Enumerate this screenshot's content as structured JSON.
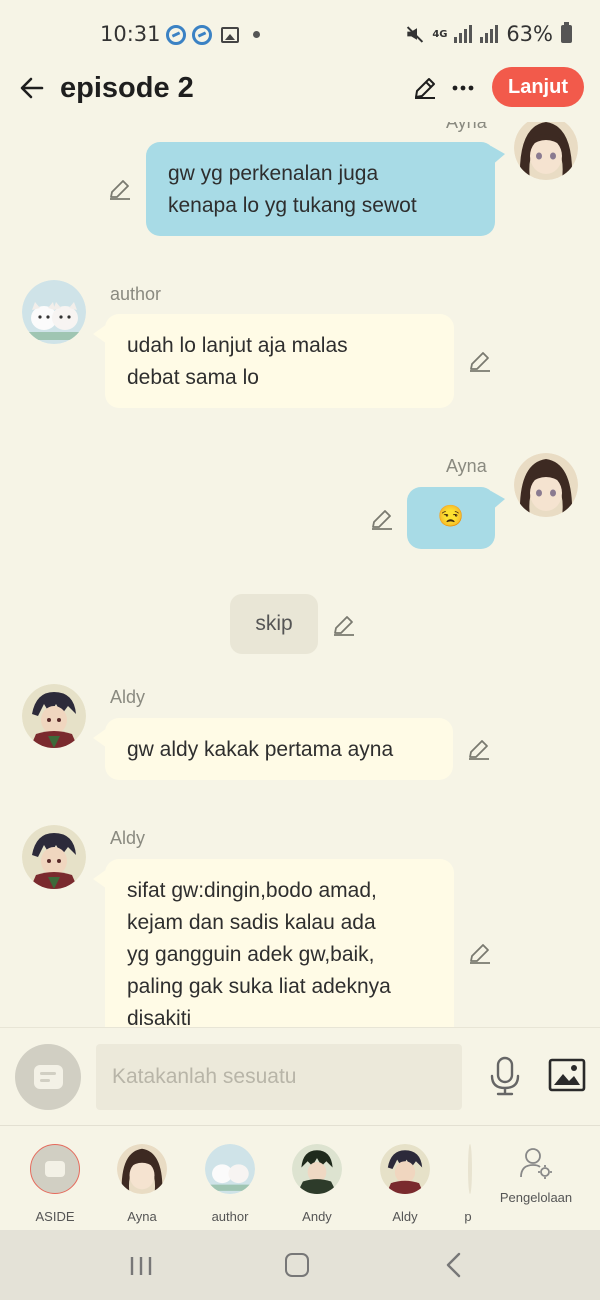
{
  "status_bar": {
    "time": "10:31",
    "network": "4G",
    "battery": "63%"
  },
  "header": {
    "title": "episode 2",
    "continue_button": "Lanjut"
  },
  "messages": [
    {
      "sender": "Ayna",
      "side": "right",
      "text": "gw yg perkenalan juga\nkenapa lo yg  tukang sewot"
    },
    {
      "sender": "author",
      "side": "left",
      "text": "udah lo lanjut aja malas\ndebat sama lo"
    },
    {
      "sender": "Ayna",
      "side": "right",
      "text": "😒"
    },
    {
      "type": "aside",
      "text": "skip"
    },
    {
      "sender": "Aldy",
      "side": "left",
      "text": "gw aldy  kakak pertama ayna"
    },
    {
      "sender": "Aldy",
      "side": "left",
      "text": "sifat gw:dingin,bodo amad,\nkejam dan sadis kalau ada\nyg gangguin adek gw,baik,\npaling gak suka liat adeknya\ndisakiti"
    }
  ],
  "input": {
    "placeholder": "Katakanlah sesuatu"
  },
  "characters": [
    {
      "label": "ASIDE"
    },
    {
      "label": "Ayna"
    },
    {
      "label": "author"
    },
    {
      "label": "Andy"
    },
    {
      "label": "Aldy"
    },
    {
      "label": "p"
    }
  ],
  "management_label": "Pengelolaan",
  "colors": {
    "accent": "#f25a4b",
    "right_bubble": "#a8dbe6",
    "left_bubble": "#fffbe6",
    "background": "#f6f4e6"
  }
}
